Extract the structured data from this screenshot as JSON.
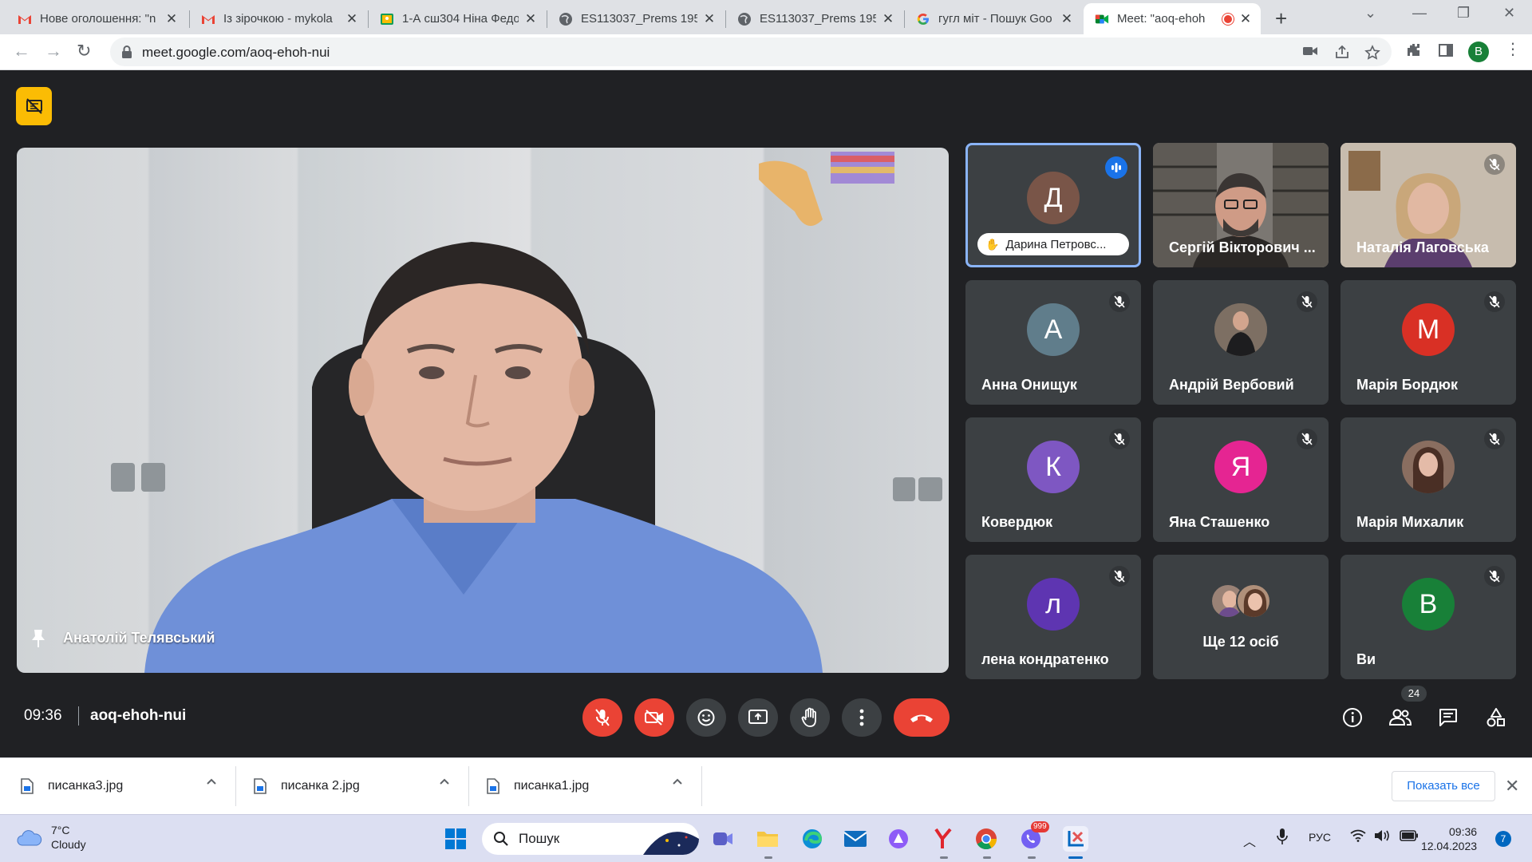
{
  "browser": {
    "tabs": [
      {
        "title": "Нове оголошення: \"n",
        "favicon": "gmail-icon"
      },
      {
        "title": "Із зірочкою - mykola",
        "favicon": "gmail-icon"
      },
      {
        "title": "1-А сш304 Ніна Федо",
        "favicon": "classroom-icon"
      },
      {
        "title": "ES113037_Prems 195",
        "favicon": "globe-icon"
      },
      {
        "title": "ES113037_Prems 195",
        "favicon": "globe-icon"
      },
      {
        "title": "гугл міт - Пошук Goo",
        "favicon": "google-icon"
      },
      {
        "title": "Meet: \"aoq-ehoh",
        "favicon": "meet-icon",
        "active": true
      }
    ],
    "url": "meet.google.com/aoq-ehoh-nui",
    "profile_initial": "B"
  },
  "meeting": {
    "time": "09:36",
    "code": "aoq-ehoh-nui",
    "main_speaker": "Анатолій Телявський",
    "participant_count": "24",
    "tiles": [
      {
        "name": "Дарина Петровс...",
        "initial": "Д",
        "color": "#795548",
        "speaking": true
      },
      {
        "name": "Сергій Вікторович ...",
        "video": true
      },
      {
        "name": "Наталія Лаговська",
        "video": true,
        "muted": true
      },
      {
        "name": "Анна Онищук",
        "initial": "А",
        "color": "#607d8b",
        "muted": true
      },
      {
        "name": "Андрій Вербовий",
        "photo": true,
        "muted": true
      },
      {
        "name": "Марія Бордюк",
        "initial": "М",
        "color": "#d93025",
        "muted": true
      },
      {
        "name": "Ковердюк",
        "initial": "К",
        "color": "#7e57c2",
        "muted": true
      },
      {
        "name": "Яна Сташенко",
        "initial": "Я",
        "color": "#e52592",
        "muted": true
      },
      {
        "name": "Марія Михалик",
        "photo": true,
        "muted": true
      },
      {
        "name": "лена кондратенко",
        "initial": "л",
        "color": "#5e35b1",
        "muted": true
      },
      {
        "name": "Ще 12 осіб",
        "more": true
      },
      {
        "name": "Ви",
        "initial": "B",
        "color": "#188038",
        "muted": true
      }
    ]
  },
  "downloads": {
    "items": [
      "писанка3.jpg",
      "писанка 2.jpg",
      "писанка1.jpg"
    ],
    "show_all": "Показать все"
  },
  "taskbar": {
    "temp": "7°C",
    "weather": "Cloudy",
    "search_placeholder": "Пошук",
    "lang": "РУС",
    "clock_time": "09:36",
    "clock_date": "12.04.2023",
    "notif_count": "7",
    "viber_badge": "999"
  }
}
